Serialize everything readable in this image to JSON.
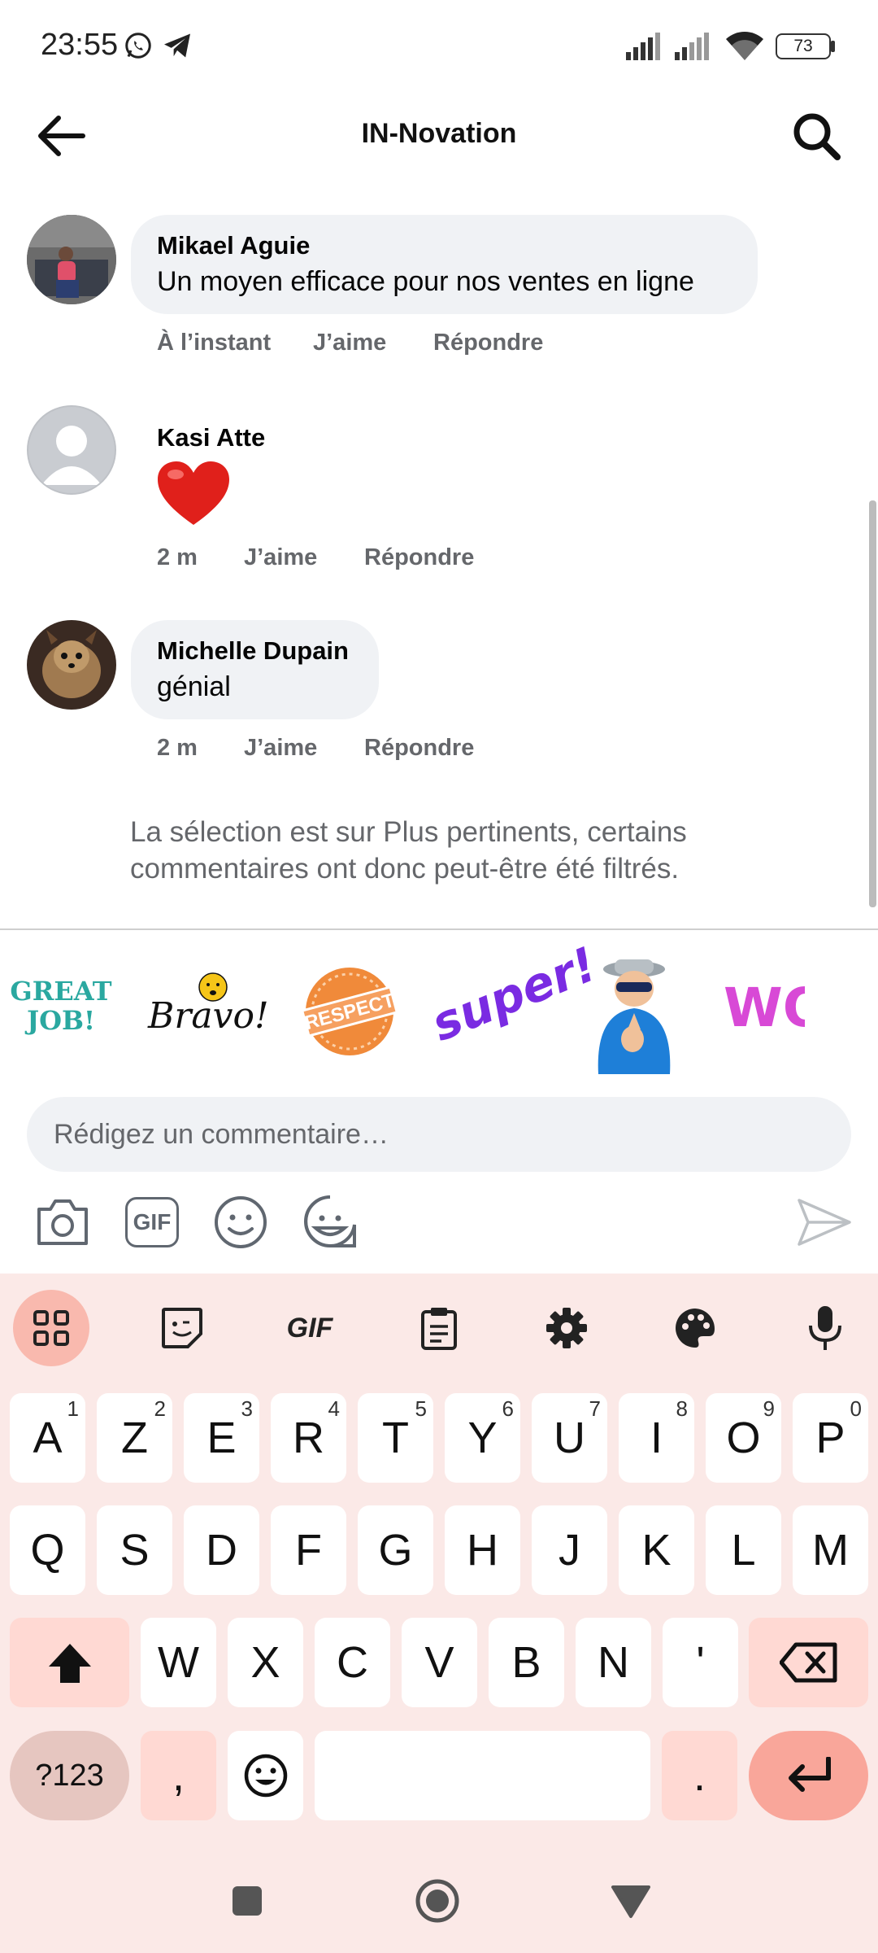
{
  "status": {
    "time": "23:55",
    "battery": "73"
  },
  "header": {
    "title": "IN-Novation"
  },
  "comments": [
    {
      "name": "Mikael Aguie",
      "text": "Un moyen efficace pour nos ventes en ligne",
      "time": "À l’instant",
      "like": "J’aime",
      "reply": "Répondre"
    },
    {
      "name": "Kasi Atte",
      "text": "❤️",
      "time": "2 m",
      "like": "J’aime",
      "reply": "Répondre"
    },
    {
      "name": "Michelle Dupain",
      "text": "génial",
      "time": "2 m",
      "like": "J’aime",
      "reply": "Répondre"
    }
  ],
  "filter_note": "La sélection est sur Plus pertinents, certains commentaires ont donc peut-être été filtrés.",
  "stickers": [
    {
      "label": "GREAT JOB!",
      "l1": "GREAT",
      "l2": "JOB!"
    },
    {
      "label": "Bravo!"
    },
    {
      "label": "RESPECT"
    },
    {
      "label": "super!"
    },
    {
      "label": "clapping-man"
    },
    {
      "label": "WOW",
      "text": "WOW"
    }
  ],
  "composer": {
    "placeholder": "Rédigez un commentaire…",
    "gif_label": "GIF"
  },
  "keyboard": {
    "toolbar_gif": "GIF",
    "row1": [
      {
        "k": "A",
        "h": "1"
      },
      {
        "k": "Z",
        "h": "2"
      },
      {
        "k": "E",
        "h": "3"
      },
      {
        "k": "R",
        "h": "4"
      },
      {
        "k": "T",
        "h": "5"
      },
      {
        "k": "Y",
        "h": "6"
      },
      {
        "k": "U",
        "h": "7"
      },
      {
        "k": "I",
        "h": "8"
      },
      {
        "k": "O",
        "h": "9"
      },
      {
        "k": "P",
        "h": "0"
      }
    ],
    "row2": [
      "Q",
      "S",
      "D",
      "F",
      "G",
      "H",
      "J",
      "K",
      "L",
      "M"
    ],
    "row3": [
      "W",
      "X",
      "C",
      "V",
      "B",
      "N",
      "'"
    ],
    "symbols": "?123",
    "comma": ",",
    "period": "."
  },
  "colors": {
    "bubble": "#f0f2f5",
    "keyboard_bg": "#fbe9e7",
    "function_key": "#ffd9d3",
    "enter_key": "#f9a69a",
    "secondary_text": "#65676b"
  }
}
